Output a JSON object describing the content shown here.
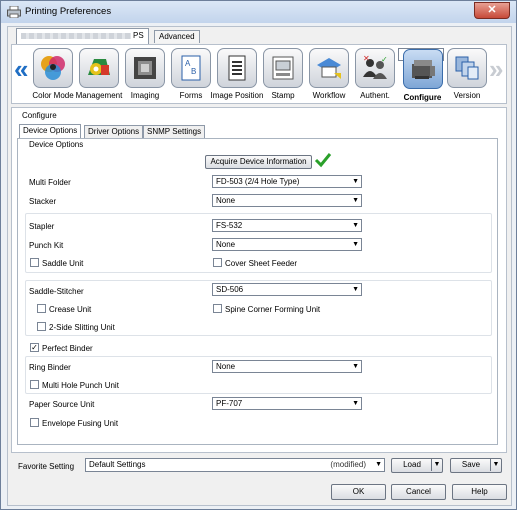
{
  "window": {
    "title": "Printing Preferences",
    "close_glyph": "✕"
  },
  "top_tabs": {
    "ps_label": "PS",
    "advanced_label": "Advanced"
  },
  "functions": [
    {
      "label": "Color Mode",
      "icon": "color-mode-icon"
    },
    {
      "label": "Management",
      "icon": "management-icon"
    },
    {
      "label": "Imaging",
      "icon": "imaging-icon"
    },
    {
      "label": "Forms",
      "icon": "forms-icon"
    },
    {
      "label": "Image Position",
      "icon": "image-position-icon"
    },
    {
      "label": "Stamp",
      "icon": "stamp-icon"
    },
    {
      "label": "Workflow",
      "icon": "workflow-icon"
    },
    {
      "label": "Authent.",
      "icon": "authentication-icon"
    },
    {
      "label": "Configure",
      "icon": "configure-icon",
      "selected": true
    },
    {
      "label": "Version",
      "icon": "version-icon"
    }
  ],
  "configure": {
    "section_label": "Configure",
    "tabs": [
      "Device Options",
      "Driver Options",
      "SNMP Settings"
    ],
    "group_label": "Device Options",
    "acquire_button": "Acquire Device Information",
    "rows": {
      "multi_folder": {
        "label": "Multi Folder",
        "value": "FD-503 (2/4 Hole Type)"
      },
      "stacker": {
        "label": "Stacker",
        "value": "None"
      },
      "stapler": {
        "label": "Stapler",
        "value": "FS-532"
      },
      "punch_kit": {
        "label": "Punch Kit",
        "value": "None"
      },
      "saddle_unit": {
        "label": "Saddle Unit",
        "checked": false
      },
      "cover_sheet_feeder": {
        "label": "Cover Sheet Feeder",
        "checked": false
      },
      "saddle_stitcher": {
        "label": "Saddle-Stitcher",
        "value": "SD-506"
      },
      "crease_unit": {
        "label": "Crease Unit",
        "checked": false
      },
      "spine_corner": {
        "label": "Spine Corner Forming Unit",
        "checked": false
      },
      "slitting_unit": {
        "label": "2-Side Slitting Unit",
        "checked": false
      },
      "perfect_binder": {
        "label": "Perfect Binder",
        "checked": true
      },
      "ring_binder": {
        "label": "Ring Binder",
        "value": "None"
      },
      "multi_hole_punch": {
        "label": "Multi Hole Punch Unit",
        "checked": false
      },
      "paper_source_unit": {
        "label": "Paper Source Unit",
        "value": "PF-707"
      },
      "envelope_fusing": {
        "label": "Envelope Fusing Unit",
        "checked": false
      }
    }
  },
  "favorite": {
    "label": "Favorite Setting",
    "value": "Default Settings",
    "status": "(modified)",
    "load": "Load",
    "save": "Save"
  },
  "footer": {
    "ok": "OK",
    "cancel": "Cancel",
    "help": "Help"
  },
  "colors": {
    "accent": "#1f6ec4",
    "check": "#2aa02a"
  }
}
